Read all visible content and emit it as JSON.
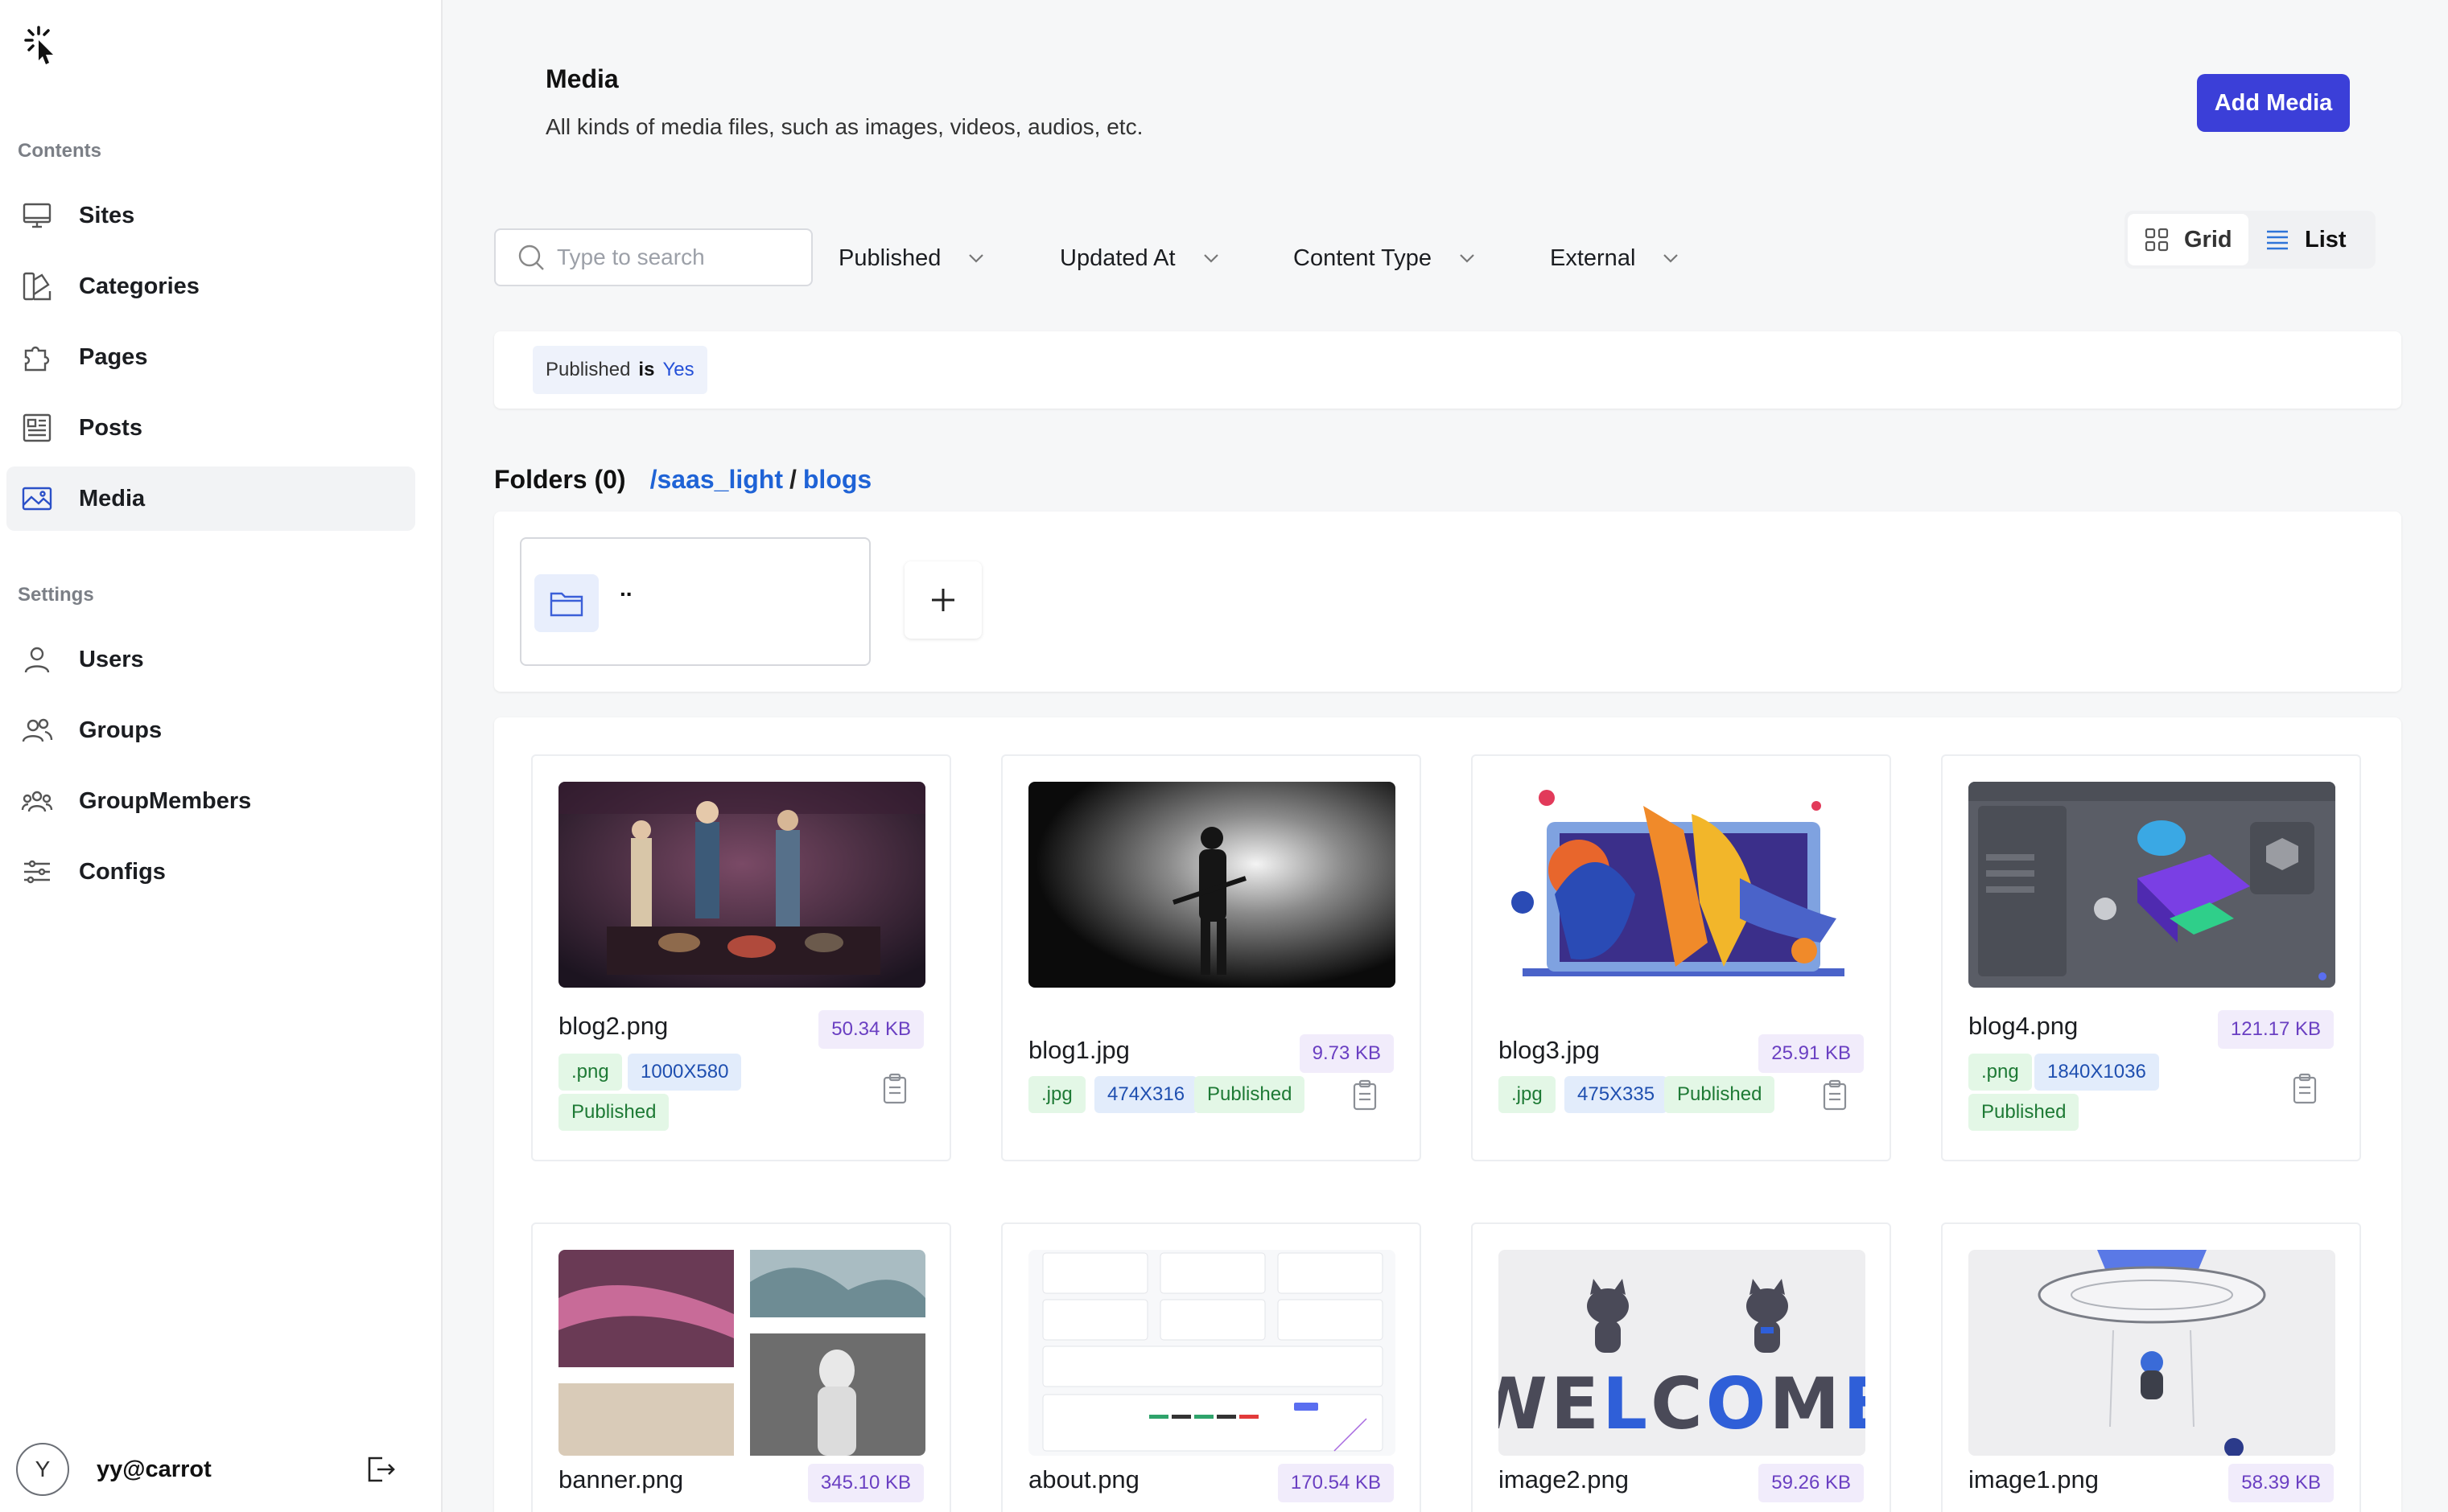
{
  "sidebar": {
    "contents_label": "Contents",
    "settings_label": "Settings",
    "items": [
      {
        "label": "Sites"
      },
      {
        "label": "Categories"
      },
      {
        "label": "Pages"
      },
      {
        "label": "Posts"
      },
      {
        "label": "Media"
      },
      {
        "label": "Users"
      },
      {
        "label": "Groups"
      },
      {
        "label": "GroupMembers"
      },
      {
        "label": "Configs"
      }
    ],
    "user": {
      "initial": "Y",
      "name": "yy@carrot"
    }
  },
  "header": {
    "title": "Media",
    "description": "All kinds of media files, such as images, videos, audios, etc.",
    "add_button": "Add Media"
  },
  "toolbar": {
    "search_placeholder": "Type to search",
    "filters": [
      "Published",
      "Updated At",
      "Content Type",
      "External"
    ],
    "view_grid": "Grid",
    "view_list": "List"
  },
  "active_filter": {
    "field": "Published",
    "op": "is",
    "value": "Yes"
  },
  "folders": {
    "heading": "Folders (0)",
    "breadcrumb": [
      "/saas_light",
      "blogs"
    ],
    "parent_label": ".."
  },
  "files": [
    {
      "name": "blog2.png",
      "size": "50.34 KB",
      "ext": ".png",
      "dims": "1000X580",
      "status": "Published"
    },
    {
      "name": "blog1.jpg",
      "size": "9.73 KB",
      "ext": ".jpg",
      "dims": "474X316",
      "status": "Published"
    },
    {
      "name": "blog3.jpg",
      "size": "25.91 KB",
      "ext": ".jpg",
      "dims": "475X335",
      "status": "Published"
    },
    {
      "name": "blog4.png",
      "size": "121.17 KB",
      "ext": ".png",
      "dims": "1840X1036",
      "status": "Published"
    },
    {
      "name": "banner.png",
      "size": "345.10 KB"
    },
    {
      "name": "about.png",
      "size": "170.54 KB"
    },
    {
      "name": "image2.png",
      "size": "59.26 KB"
    },
    {
      "name": "image1.png",
      "size": "58.39 KB"
    }
  ],
  "colors": {
    "accent": "#3b3fd8",
    "link": "#1f63d6"
  }
}
